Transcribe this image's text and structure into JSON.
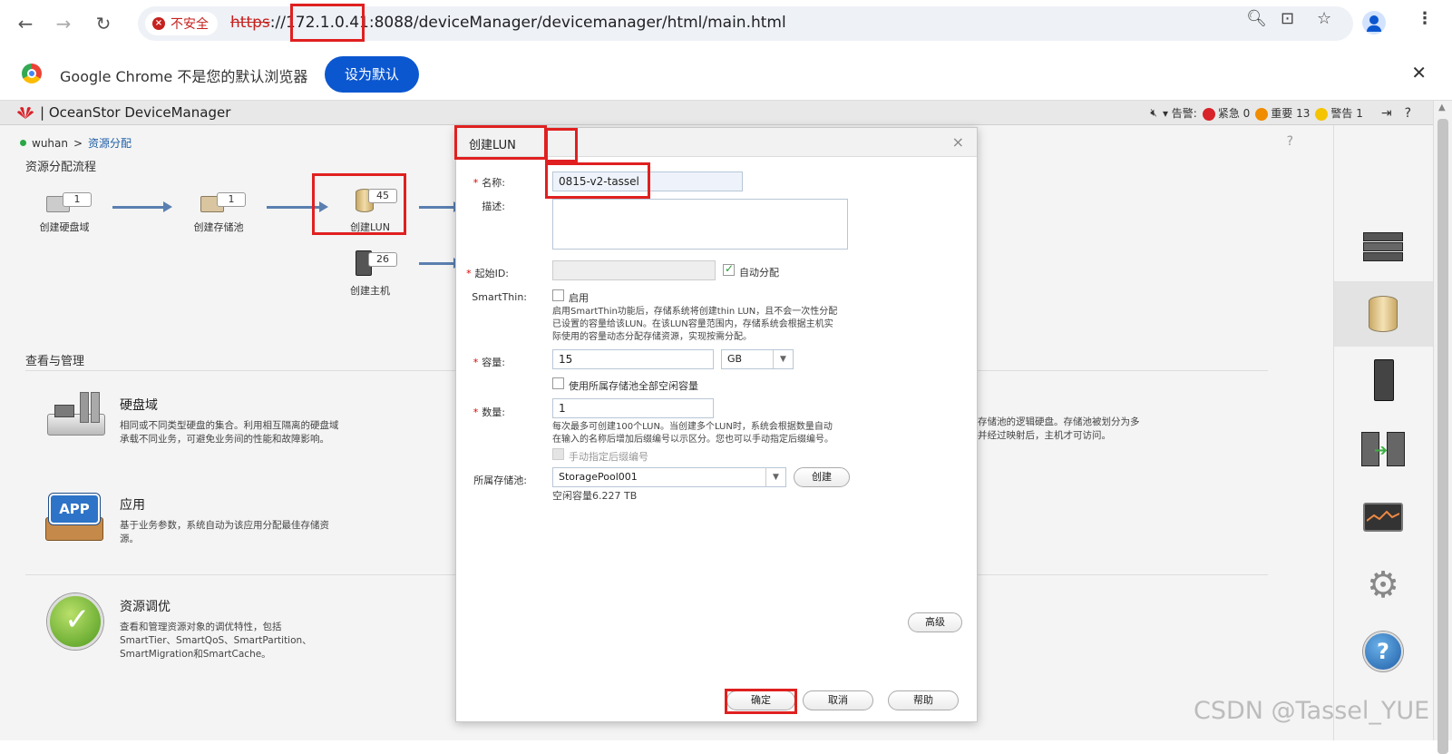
{
  "browser": {
    "insecure_label": "不安全",
    "url_scheme": "https",
    "url_rest": "://172.1.0.41:8088/deviceManager/devicemanager/html/main.html",
    "default_msg": "Google Chrome 不是您的默认浏览器",
    "set_default": "设为默认"
  },
  "app": {
    "title": "| OceanStor DeviceManager",
    "alarm_label": "▾ 告警:",
    "critical": "紧急 0",
    "major": "重要 13",
    "warning": "警告 1",
    "breadcrumb_root": "wuhan",
    "breadcrumb_sep": ">",
    "breadcrumb_current": "资源分配",
    "help_q": "?",
    "flow_title": "资源分配流程",
    "manage_title": "查看与管理"
  },
  "flow": {
    "disk_domain": {
      "label": "创建硬盘域",
      "count": "1"
    },
    "storage_pool": {
      "label": "创建存储池",
      "count": "1"
    },
    "lun": {
      "label": "创建LUN",
      "count": "45"
    },
    "host": {
      "label": "创建主机",
      "count": "26"
    }
  },
  "mgmt": {
    "disk_domain": {
      "title": "硬盘域",
      "desc": "相同或不同类型硬盘的集合。利用相互隔离的硬盘域承载不同业务，可避免业务间的性能和故障影响。"
    },
    "app": {
      "title": "应用",
      "desc": "基于业务参数，系统自动为该应用分配最佳存储资源。",
      "icon_text": "APP"
    },
    "tuning": {
      "title": "资源调优",
      "desc_line1": "查看和管理资源对象的调优特性，包括",
      "desc_line2": "SmartTier、SmartQoS、SmartPartition、",
      "desc_line3": "SmartMigration和SmartCache。"
    },
    "partial_right_line1": "存储池的逻辑硬盘。存储池被划分为多",
    "partial_right_line2": "并经过映射后，主机才可访问。"
  },
  "dialog": {
    "title": "创建LUN",
    "close": "×",
    "name_label": "名称:",
    "name_value": "0815-v2-tassel",
    "desc_label": "描述:",
    "start_id_label": "起始ID:",
    "auto_assign": "自动分配",
    "smartthin_label": "SmartThin:",
    "enable": "启用",
    "smartthin_hint_1": "启用SmartThin功能后，存储系统将创建thin LUN，且不会一次性分配",
    "smartthin_hint_2": "已设置的容量给该LUN。在该LUN容量范围内，存储系统会根据主机实",
    "smartthin_hint_3": "际使用的容量动态分配存储资源，实现按需分配。",
    "capacity_label": "容量:",
    "capacity_value": "15",
    "capacity_unit": "GB",
    "use_all_free": "使用所属存储池全部空闲容量",
    "quantity_label": "数量:",
    "quantity_value": "1",
    "quantity_hint_1": "每次最多可创建100个LUN。当创建多个LUN时，系统会根据数量自动",
    "quantity_hint_2": "在输入的名称后增加后缀编号以示区分。您也可以手动指定后缀编号。",
    "manual_suffix": "手动指定后缀编号",
    "pool_label": "所属存储池:",
    "pool_value": "StoragePool001",
    "create_btn": "创建",
    "free_capacity": "空闲容量6.227 TB",
    "advanced_btn": "高级",
    "ok_btn": "确定",
    "cancel_btn": "取消",
    "help_btn": "帮助"
  },
  "watermark": "CSDN @Tassel_YUE",
  "colors": {
    "accent_red": "#e02020",
    "chrome_blue": "#0b57d0",
    "link_blue": "#1f5fa8"
  }
}
